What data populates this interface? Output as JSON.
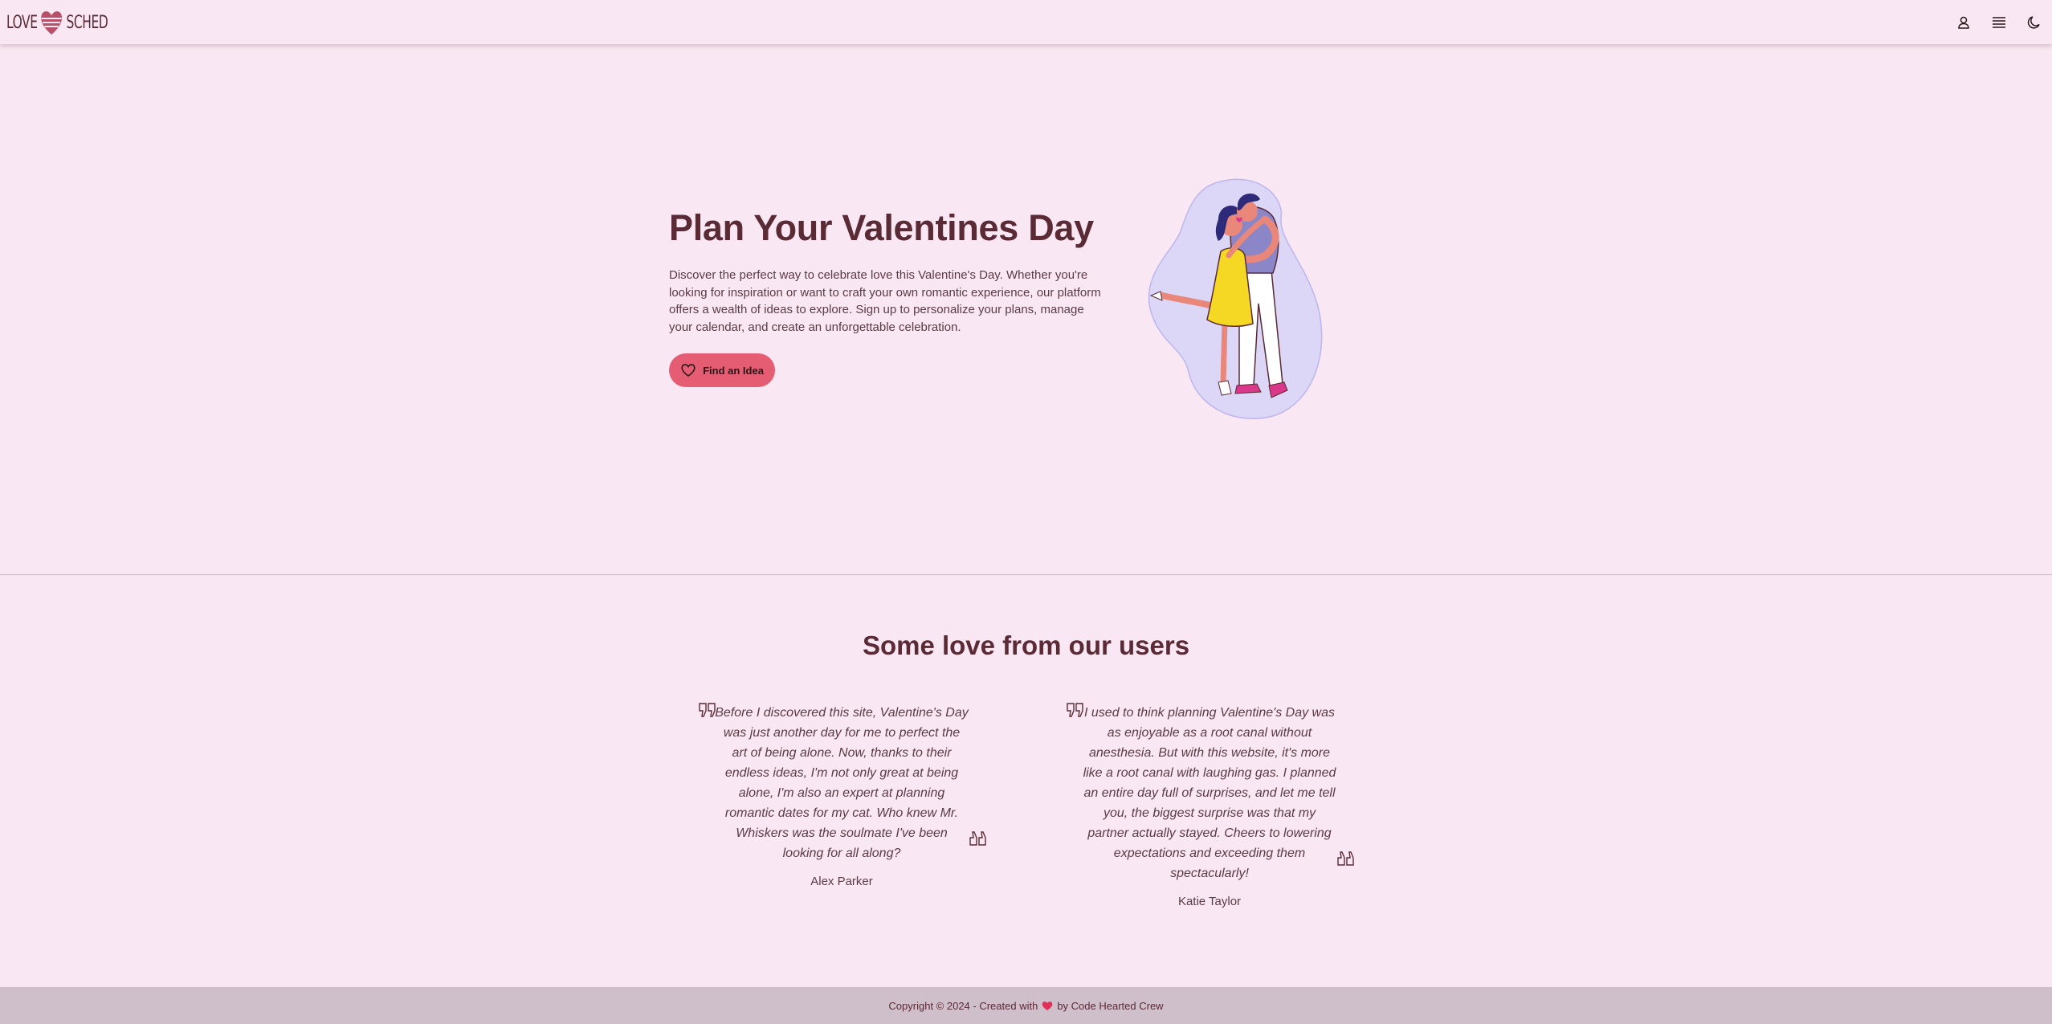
{
  "header": {
    "logo_left": "LOVE",
    "logo_right": "SCHED",
    "icons": [
      "user-icon",
      "menu-icon",
      "moon-icon"
    ]
  },
  "hero": {
    "title": "Plan Your Valentines Day",
    "description": "Discover the perfect way to celebrate love this Valentine's Day. Whether you're looking for inspiration or want to craft your own romantic experience, our platform offers a wealth of ideas to explore. Sign up to personalize your plans, manage your calendar, and create an unforgettable celebration.",
    "cta_label": "Find an Idea",
    "cta_icon": "heart-icon"
  },
  "testimonials": {
    "title": "Some love from our users",
    "items": [
      {
        "quote": "Before I discovered this site, Valentine's Day was just another day for me to perfect the art of being alone. Now, thanks to their endless ideas, I'm not only great at being alone, I'm also an expert at planning romantic dates for my cat. Who knew Mr. Whiskers was the soulmate I've been looking for all along?",
        "author": "Alex Parker"
      },
      {
        "quote": "I used to think planning Valentine's Day was as enjoyable as a root canal without anesthesia. But with this website, it's more like a root canal with laughing gas. I planned an entire day full of surprises, and let me tell you, the biggest surprise was that my partner actually stayed. Cheers to lowering expectations and exceeding them spectacularly!",
        "author": "Katie Taylor"
      }
    ]
  },
  "footer": {
    "prefix": "Copyright © 2024 - Created with",
    "suffix": "by Code Hearted Crew"
  },
  "colors": {
    "background": "#f9e8f3",
    "text": "#5a2a35",
    "accent": "#e55d72",
    "footer_bg": "#cfbfcb"
  }
}
